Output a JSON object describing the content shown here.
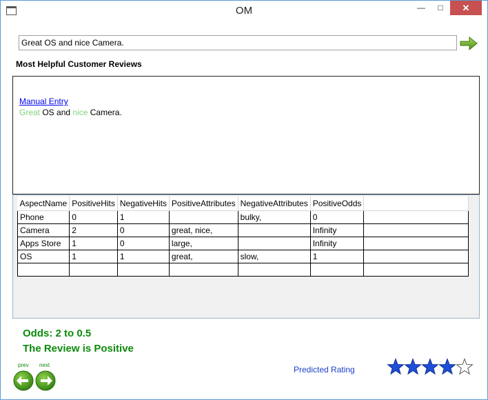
{
  "window": {
    "title": "OM"
  },
  "input": {
    "value": "Great OS and nice Camera."
  },
  "section_title": "Most Helpful Customer Reviews",
  "review": {
    "source_link": "Manual Entry",
    "segments": [
      {
        "text": "Great",
        "positive": true
      },
      {
        "text": " OS and ",
        "positive": false
      },
      {
        "text": "nice",
        "positive": true
      },
      {
        "text": " Camera.",
        "positive": false
      }
    ]
  },
  "table": {
    "columns": [
      "AspectName",
      "PositiveHits",
      "NegativeHits",
      "PositiveAttributes",
      "NegativeAttributes",
      "PositiveOdds"
    ],
    "rows": [
      [
        "Phone",
        "0",
        "1",
        "",
        "bulky,",
        "0"
      ],
      [
        "Camera",
        "2",
        "0",
        "great, nice,",
        "",
        "Infinity"
      ],
      [
        "Apps Store",
        "1",
        "0",
        "large,",
        "",
        "Infinity"
      ],
      [
        "OS",
        "1",
        "1",
        "great,",
        "slow,",
        "1"
      ],
      [
        "",
        "",
        "",
        "",
        "",
        ""
      ]
    ]
  },
  "result": {
    "odds": "Odds: 2 to 0.5",
    "verdict": "The Review is Positive"
  },
  "nav": {
    "prev_label": "prev",
    "next_label": "next"
  },
  "prediction": {
    "label": "Predicted Rating",
    "rating": 4,
    "max_rating": 5
  },
  "colors": {
    "positive_word": "#7ed27e",
    "result_text": "#0b8a0b",
    "star_fill": "#1f4fd8",
    "close_button": "#c75050"
  }
}
